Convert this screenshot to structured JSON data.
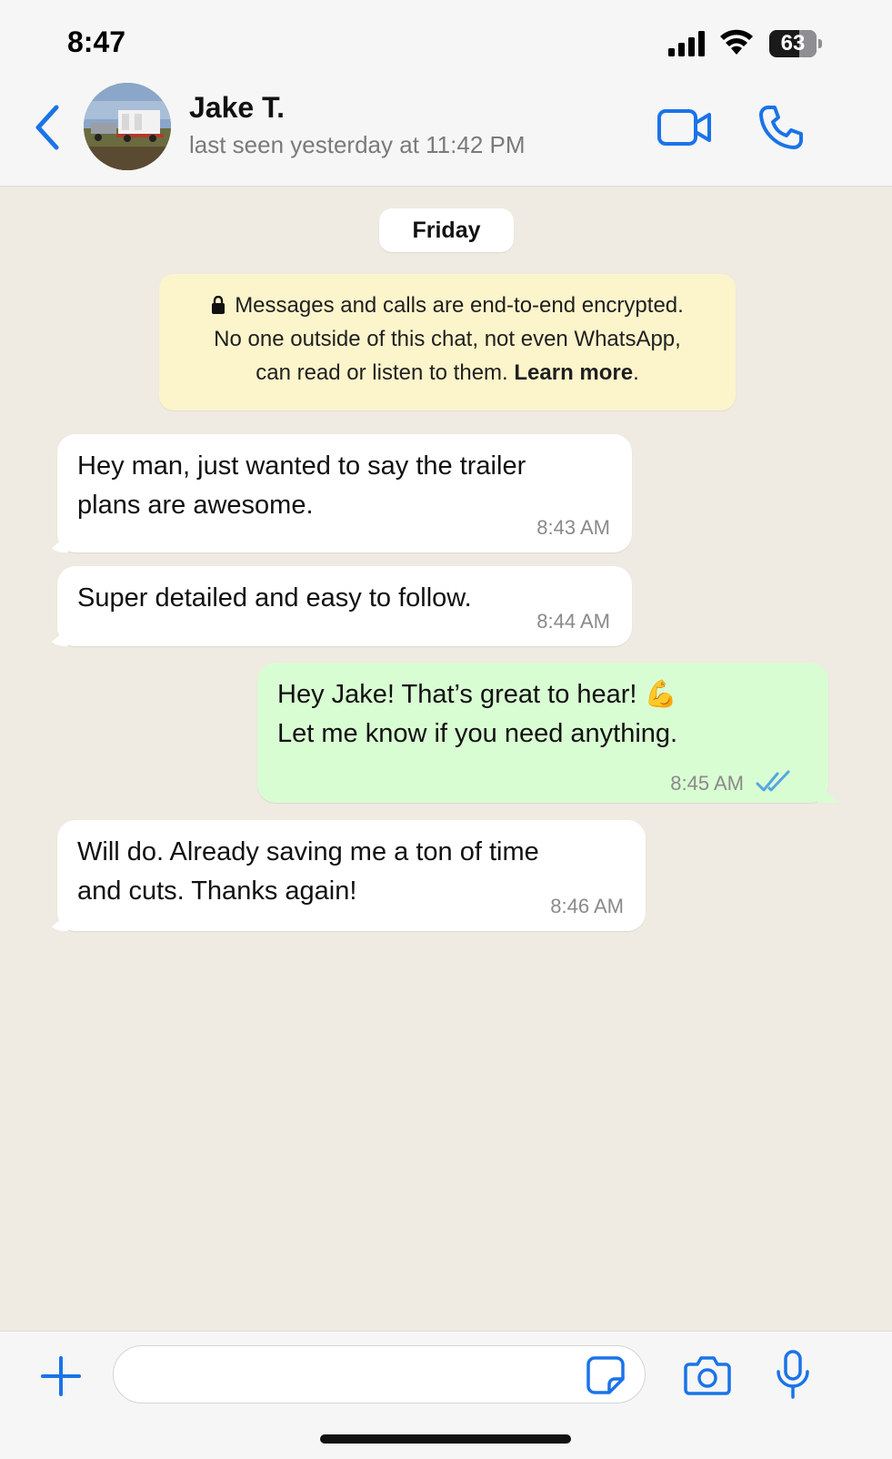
{
  "status_bar": {
    "time": "8:47",
    "battery": "63"
  },
  "header": {
    "contact_name": "Jake T.",
    "last_seen": "last seen yesterday at 11:42 PM"
  },
  "chat": {
    "day_label": "Friday",
    "encryption_notice": {
      "line1": "Messages and calls are end-to-end encrypted.",
      "line2": "No one outside of this chat, not even WhatsApp,",
      "line3_prefix": "can read or listen to them.",
      "link": "Learn more",
      "line3_suffix": "."
    },
    "messages": [
      {
        "direction": "incoming",
        "lines": [
          "Hey man, just wanted to say the trailer",
          "plans are awesome."
        ],
        "time": "8:43 AM"
      },
      {
        "direction": "incoming",
        "lines": [
          "Super detailed and easy to follow."
        ],
        "time": "8:44 AM"
      },
      {
        "direction": "outgoing",
        "lines": [
          "Hey Jake! That’s great to hear! 💪",
          "Let me know if you need anything."
        ],
        "time": "8:45 AM",
        "status": "read"
      },
      {
        "direction": "incoming",
        "lines": [
          "Will do. Already saving me a ton of time",
          "and cuts. Thanks again!"
        ],
        "time": "8:46 AM"
      }
    ]
  },
  "composer": {
    "input_value": "",
    "placeholder": ""
  },
  "colors": {
    "accent": "#1a73e8",
    "chat_background": "#efeae2",
    "incoming_bubble": "#ffffff",
    "outgoing_bubble": "#d9fdd3",
    "notice_background": "#fcf4cb",
    "read_ticks": "#53a6e0"
  },
  "icons": [
    "back-chevron-icon",
    "video-camera-icon",
    "phone-icon",
    "lock-icon",
    "double-check-icon",
    "plus-icon",
    "sticker-icon",
    "camera-icon",
    "microphone-icon"
  ]
}
